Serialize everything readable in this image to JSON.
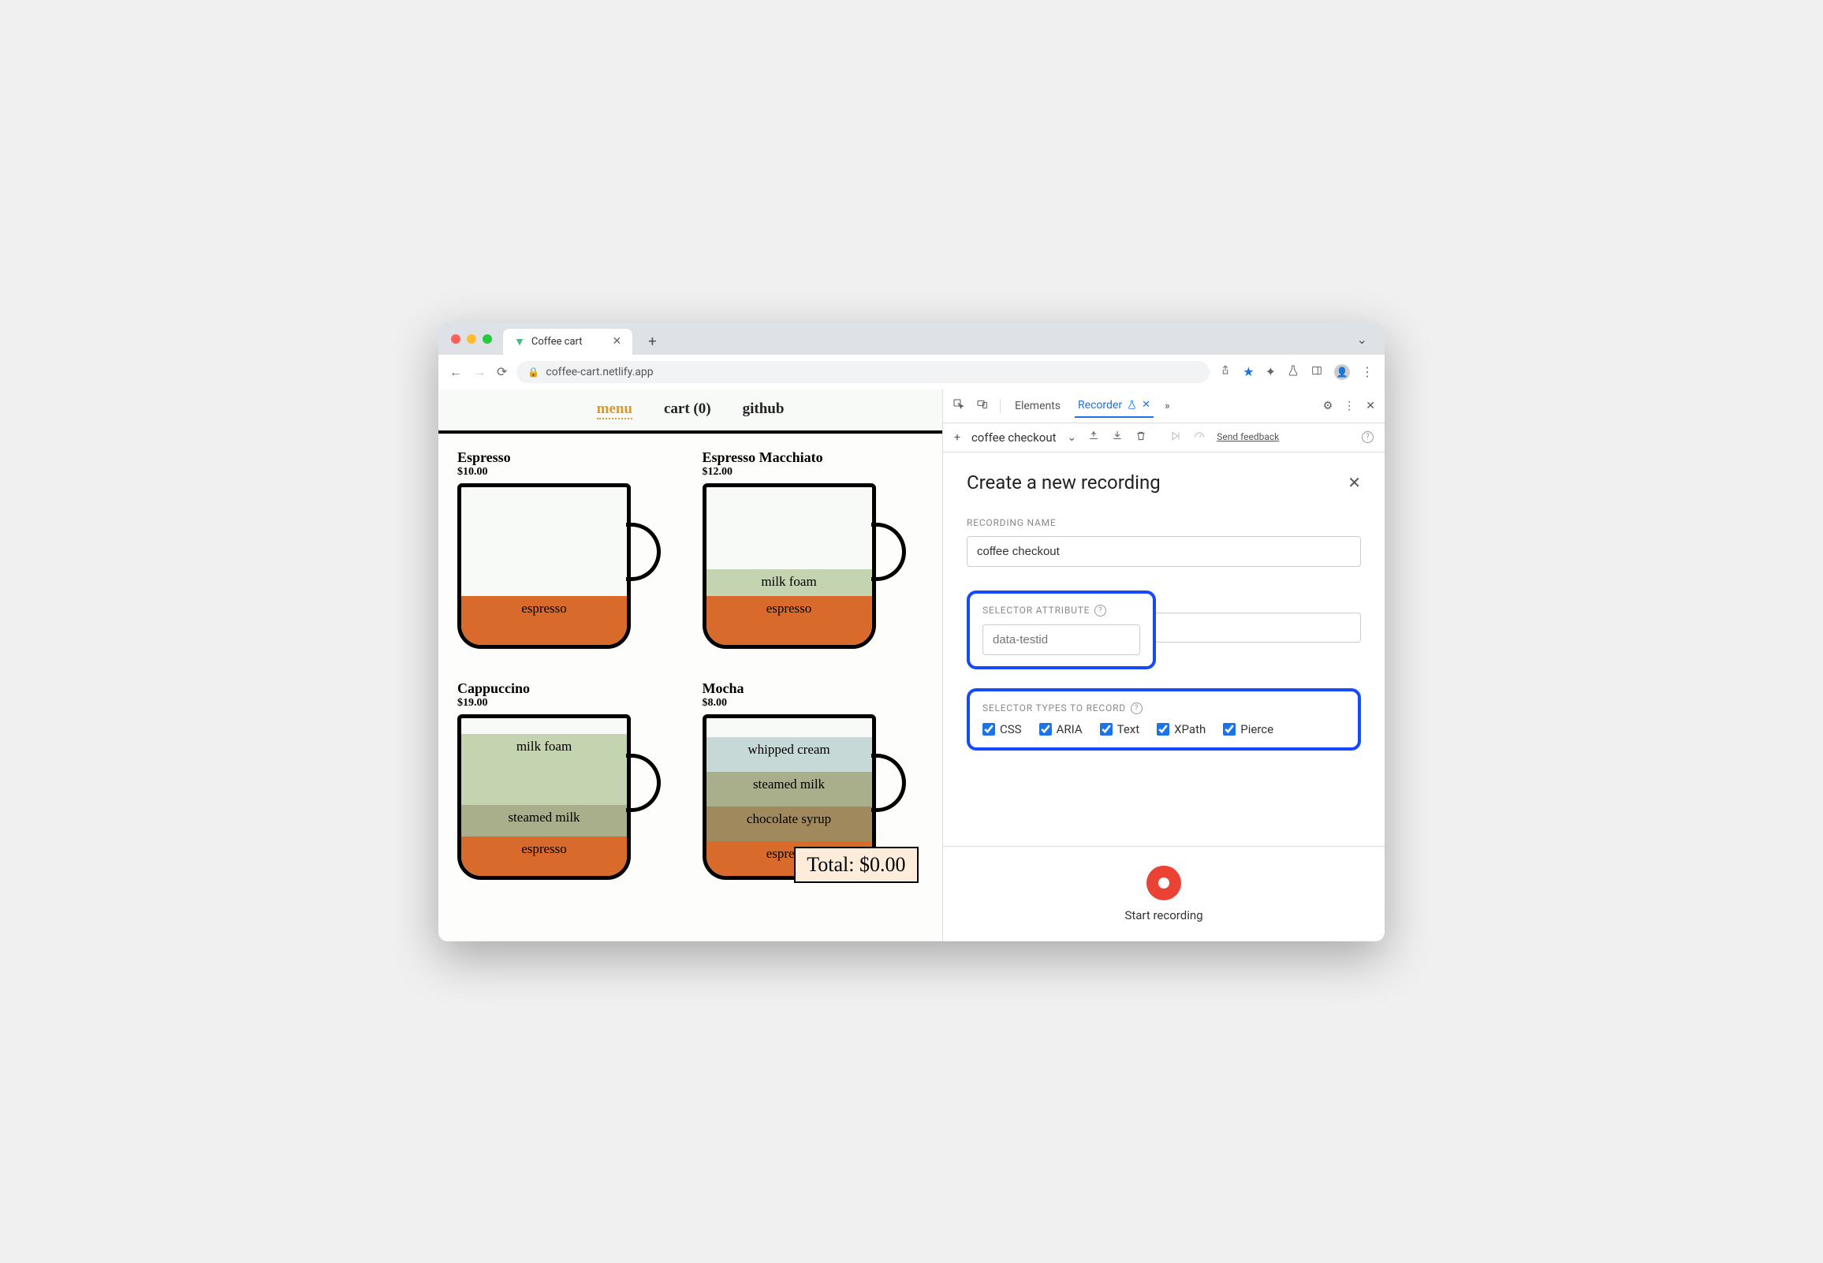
{
  "browser": {
    "tab_title": "Coffee cart",
    "url": "coffee-cart.netlify.app"
  },
  "page": {
    "nav": {
      "menu": "menu",
      "cart": "cart (0)",
      "github": "github"
    },
    "products": [
      {
        "name": "Espresso",
        "price": "$10.00",
        "layers": [
          {
            "label": "espresso",
            "cls": "l-espresso",
            "h": 62
          }
        ]
      },
      {
        "name": "Espresso Macchiato",
        "price": "$12.00",
        "layers": [
          {
            "label": "milk foam",
            "cls": "l-milkfoam",
            "h": 34
          },
          {
            "label": "espresso",
            "cls": "l-espresso",
            "h": 62
          }
        ]
      },
      {
        "name": "Cappuccino",
        "price": "$19.00",
        "layers": [
          {
            "label": "milk foam",
            "cls": "l-milkfoam",
            "h": 90
          },
          {
            "label": "steamed milk",
            "cls": "l-steamed",
            "h": 40
          },
          {
            "label": "espresso",
            "cls": "l-espresso",
            "h": 50
          }
        ]
      },
      {
        "name": "Mocha",
        "price": "$8.00",
        "layers": [
          {
            "label": "whipped cream",
            "cls": "l-whip",
            "h": 44
          },
          {
            "label": "steamed milk",
            "cls": "l-steamed",
            "h": 44
          },
          {
            "label": "chocolate syrup",
            "cls": "l-choc",
            "h": 44
          },
          {
            "label": "espresso",
            "cls": "l-espresso",
            "h": 44
          }
        ]
      }
    ],
    "total": "Total: $0.00"
  },
  "devtools": {
    "tabs": {
      "elements": "Elements",
      "recorder": "Recorder"
    },
    "subbar": {
      "flow_name": "coffee checkout",
      "feedback": "Send feedback"
    },
    "panel": {
      "title": "Create a new recording",
      "name_label": "RECORDING NAME",
      "name_value": "coffee checkout",
      "attr_label": "SELECTOR ATTRIBUTE",
      "attr_placeholder": "data-testid",
      "types_label": "SELECTOR TYPES TO RECORD",
      "types": [
        {
          "label": "CSS",
          "checked": true
        },
        {
          "label": "ARIA",
          "checked": true
        },
        {
          "label": "Text",
          "checked": true
        },
        {
          "label": "XPath",
          "checked": true
        },
        {
          "label": "Pierce",
          "checked": true
        }
      ],
      "start_label": "Start recording"
    }
  }
}
